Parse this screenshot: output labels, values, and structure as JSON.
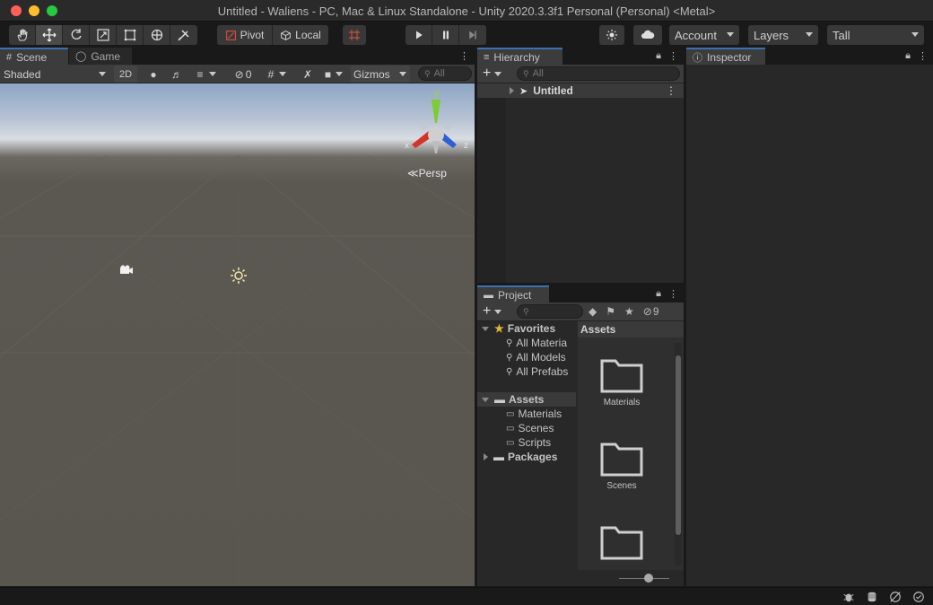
{
  "window": {
    "title": "Untitled - Waliens - PC, Mac & Linux Standalone - Unity 2020.3.3f1 Personal (Personal) <Metal>"
  },
  "toolbar": {
    "tools": [
      "hand-tool",
      "move-tool",
      "rotate-tool",
      "scale-tool",
      "rect-tool",
      "transform-tool",
      "custom-tool"
    ],
    "pivot_label": "Pivot",
    "local_label": "Local",
    "account_label": "Account",
    "layers_label": "Layers",
    "layout_label": "Tall"
  },
  "scene": {
    "tabs": [
      "Scene",
      "Game"
    ],
    "shading_mode": "Shaded",
    "mode_2d_label": "2D",
    "hidden_count": "0",
    "gizmos_label": "Gizmos",
    "search_placeholder": "All",
    "persp_label": "Persp",
    "gizmo_axes": {
      "x": "x",
      "y": "y",
      "z": "z"
    }
  },
  "hierarchy": {
    "tab_label": "Hierarchy",
    "search_placeholder": "All",
    "root_item": "Untitled"
  },
  "project": {
    "tab_label": "Project",
    "hidden_count": "9",
    "favorites_label": "Favorites",
    "favorites": [
      "All Materia",
      "All Models",
      "All Prefabs"
    ],
    "assets_label": "Assets",
    "asset_folders": [
      "Materials",
      "Scenes",
      "Scripts"
    ],
    "packages_label": "Packages",
    "main_header": "Assets",
    "tiles": [
      "Materials",
      "Scenes",
      ""
    ]
  },
  "inspector": {
    "tab_label": "Inspector"
  },
  "colors": {
    "accent": "#3a72b0",
    "panel_bg": "#282828",
    "toolbar_bg": "#191919",
    "sky_top": "#8ea5c6",
    "ground": "#59564f"
  }
}
